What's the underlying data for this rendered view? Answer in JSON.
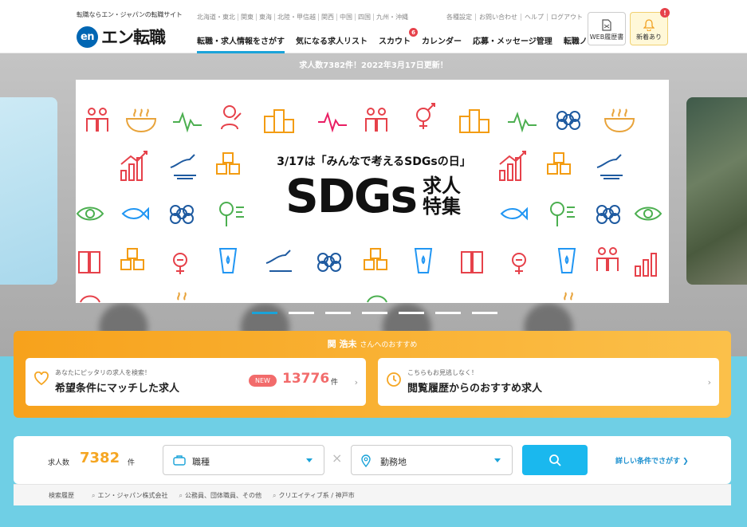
{
  "header": {
    "tagline": "転職ならエン・ジャパンの転職サイト",
    "logo_mark": "en",
    "logo_text": "エン転職",
    "regions": [
      "北海道・東北",
      "関東",
      "東海",
      "北陸・甲信越",
      "関西",
      "中国",
      "四国",
      "九州・沖縄"
    ],
    "utility_links": [
      "各種設定",
      "お問い合わせ",
      "ヘルプ",
      "ログアウト"
    ],
    "nav": [
      {
        "label": "転職・求人情報をさがす",
        "active": true
      },
      {
        "label": "気になる求人リスト"
      },
      {
        "label": "スカウト",
        "badge": "6"
      },
      {
        "label": "カレンダー"
      },
      {
        "label": "応募・メッセージ管理"
      },
      {
        "label": "転職ノウハウ"
      }
    ],
    "resume_button": "WEB履歴書",
    "notice_button": "新着あり",
    "notice_badge": "!"
  },
  "hero": {
    "job_count_notice": "求人数7382件！2022年3月17日更新！",
    "banner_subtitle": "3/17は「みんなで考えるSDGsの日」",
    "banner_main": "SDGs",
    "banner_side": "求人特集",
    "slide_count": 7,
    "active_slide": 0
  },
  "recommend": {
    "name": "関 浩未",
    "suffix": "さんへのおすすめ",
    "card1": {
      "small": "あなたにピッタリの求人を検索！",
      "title": "希望条件にマッチした求人",
      "badge": "NEW",
      "count": "13776",
      "unit": "件"
    },
    "card2": {
      "small": "こちらもお見逃しなく！",
      "title": "閲覧履歴からのおすすめ求人"
    }
  },
  "search": {
    "count_label": "求人数",
    "count": "7382",
    "count_unit": "件",
    "job_type": "職種",
    "location": "勤務地",
    "detail_link": "詳しい条件でさがす ❯",
    "history_label": "検索履歴",
    "history": [
      "エン・ジャパン株式会社",
      "公務員、団体職員、その他",
      "クリエイティブ系 / 神戸市"
    ]
  },
  "colors": {
    "accent": "#1aa3d9",
    "orange": "#f7a21c",
    "red": "#e6414a",
    "lower_bg": "#6fcfe5"
  }
}
